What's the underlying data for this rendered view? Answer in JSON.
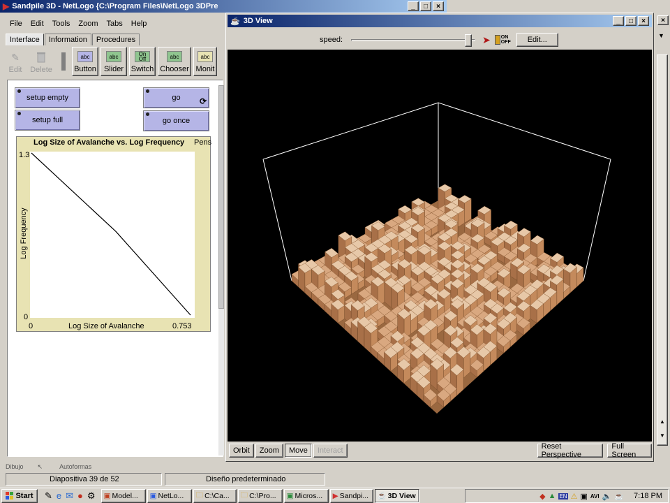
{
  "netlogo": {
    "title": "Sandpile 3D - NetLogo {C:\\Program Files\\NetLogo 3DPre",
    "menus": [
      "File",
      "Edit",
      "Tools",
      "Zoom",
      "Tabs",
      "Help"
    ],
    "tabs": [
      "Interface",
      "Information",
      "Procedures"
    ],
    "toolbar": {
      "edit": "Edit",
      "delete": "Delete",
      "button": "Button",
      "slider": "Slider",
      "switch": "Switch",
      "chooser": "Chooser",
      "monitor": "Monit",
      "switch_on": "On",
      "switch_off": "Off",
      "abc": "abc"
    },
    "buttons": {
      "setup_empty": "setup empty",
      "setup_full": "setup full",
      "go": "go",
      "go_once": "go once"
    },
    "plot": {
      "pens_label": "Pens"
    }
  },
  "chart_data": {
    "type": "line",
    "title": "Log Size of Avalanche vs. Log Frequency",
    "xlabel": "Log Size of Avalanche",
    "ylabel": "Log Frequency",
    "xlim": [
      0,
      0.753
    ],
    "ylim": [
      0,
      1.3
    ],
    "x_ticks": [
      "0",
      "0.753"
    ],
    "y_ticks": [
      "0",
      "1.3"
    ],
    "series": [
      {
        "x": [
          0,
          0.4,
          0.753
        ],
        "y": [
          1.3,
          0.67,
          0
        ]
      }
    ]
  },
  "view3d": {
    "title": "3D View",
    "speed_label": "speed:",
    "speed_value": 0.96,
    "edit_button": "Edit...",
    "on_off_top": "ON",
    "on_off_bottom": "OFF",
    "bottom_buttons": {
      "orbit": "Orbit",
      "zoom": "Zoom",
      "move": "Move",
      "interact": "Interact",
      "reset_perspective": "Reset Perspective",
      "full_screen": "Full Screen"
    },
    "colors": {
      "patch_dark": "#b07a4a",
      "patch_light": "#e7c8a8",
      "box_line": "#ffffff"
    }
  },
  "powerpoint": {
    "slide_status": "Diapositiva 39 de 52",
    "design_status": "Diseño predeterminado",
    "draw_menu": "Dibujo",
    "autoshapes": "Autoformas"
  },
  "taskbar": {
    "start": "Start",
    "tasks": [
      "Model...",
      "NetLo...",
      "C:\\Ca...",
      "C:\\Pro...",
      "Micros...",
      "Sandpi...",
      "3D View"
    ],
    "tray_lang": "EN",
    "tray_avi": "AVI",
    "clock": "7:18 PM"
  }
}
